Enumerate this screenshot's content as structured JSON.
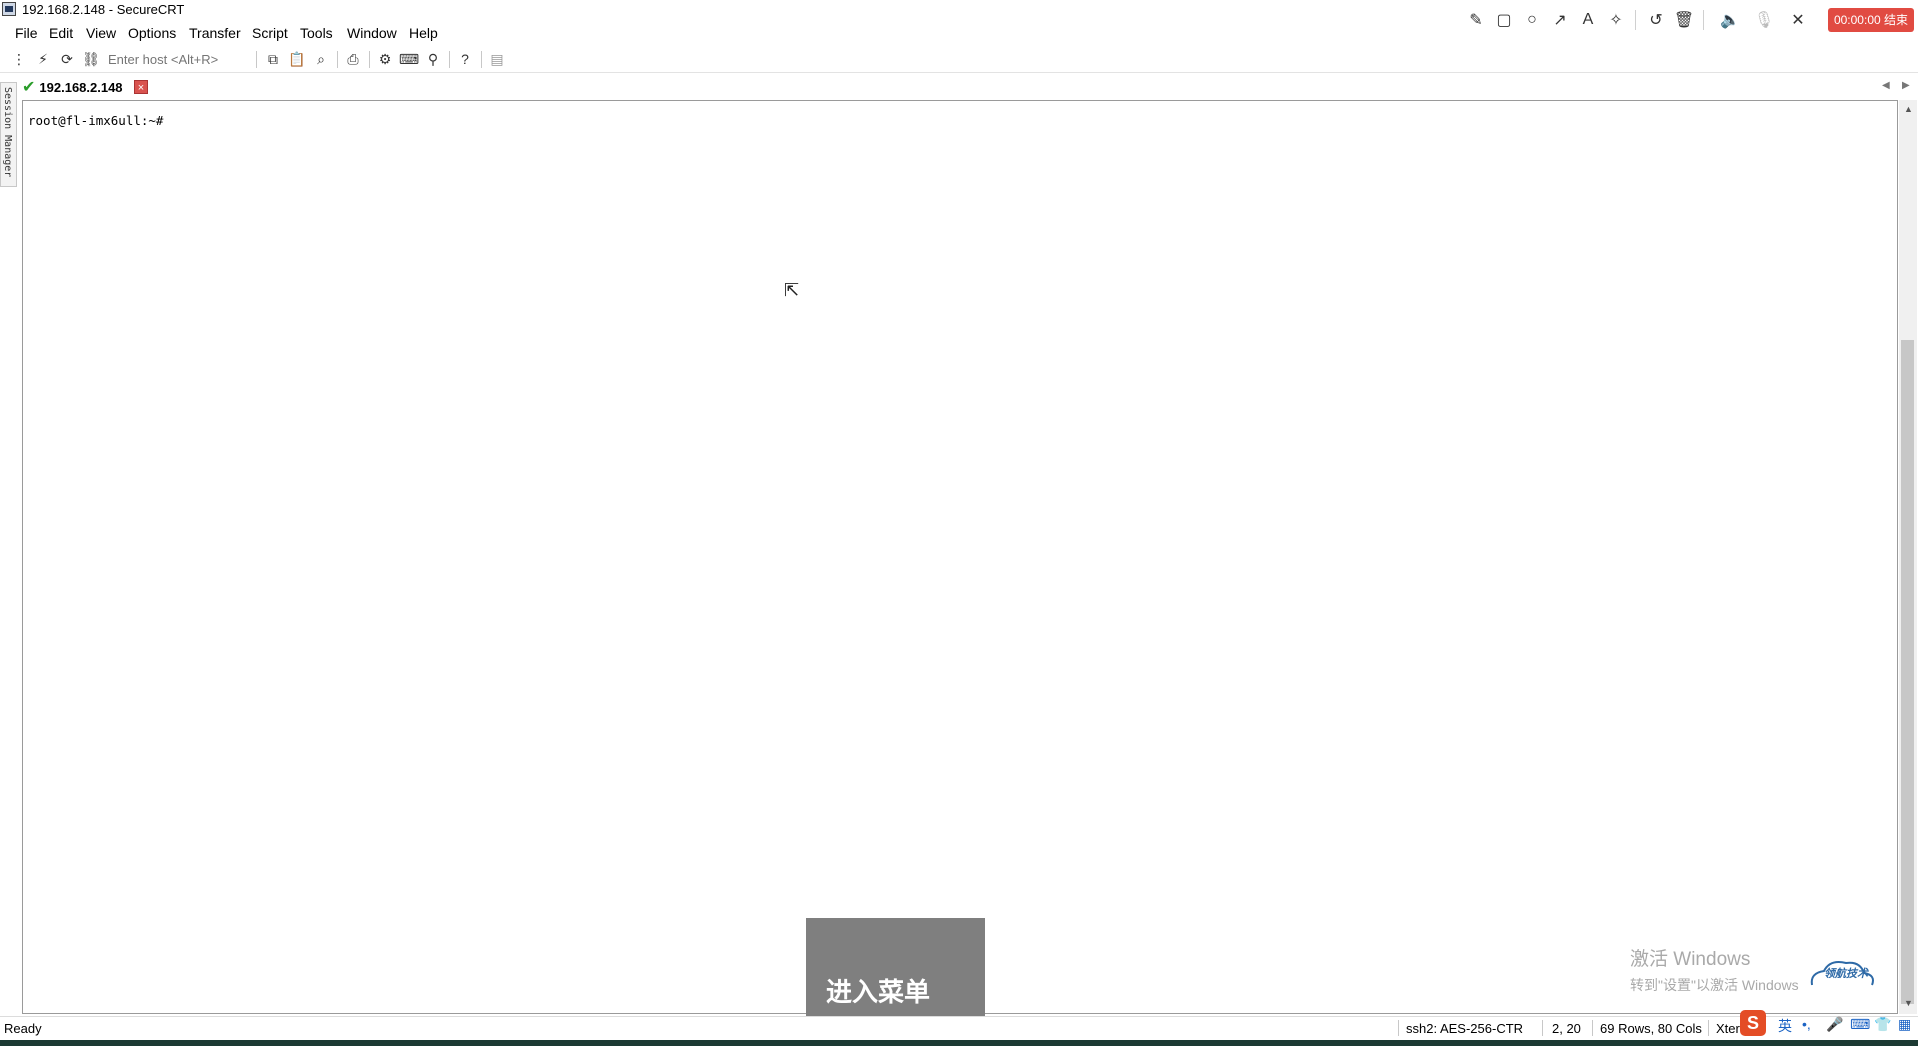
{
  "window": {
    "title": "192.168.2.148 - SecureCRT"
  },
  "recorder": {
    "timer_label": "00:00:00 结束"
  },
  "menubar": {
    "items": [
      "File",
      "Edit",
      "View",
      "Options",
      "Transfer",
      "Script",
      "Tools",
      "Window",
      "Help"
    ]
  },
  "toolbar": {
    "host_placeholder": "Enter host <Alt+R>"
  },
  "tabs": [
    {
      "label": "192.168.2.148",
      "connected": true
    }
  ],
  "session_manager": {
    "label": "Session Manager"
  },
  "terminal": {
    "prompt": "root@fl-imx6ull:~#"
  },
  "watermark": {
    "title": "激活 Windows",
    "subtitle": "转到\"设置\"以激活 Windows"
  },
  "logo": {
    "text": "领航技术"
  },
  "subtitle_overlay": {
    "text": "进入菜单"
  },
  "statusbar": {
    "status": "Ready",
    "encryption": "ssh2: AES-256-CTR",
    "position": "2,  20",
    "size": "69 Rows, 80 Cols",
    "terminal_type": "Xterm"
  },
  "tray": {
    "ime_lang": "英"
  },
  "colors": {
    "rec_timer": "#e14b42",
    "tab_close": "#d9534f",
    "connected_check": "#2a9d2a",
    "subtitle_bg": "#7f7f7f"
  }
}
